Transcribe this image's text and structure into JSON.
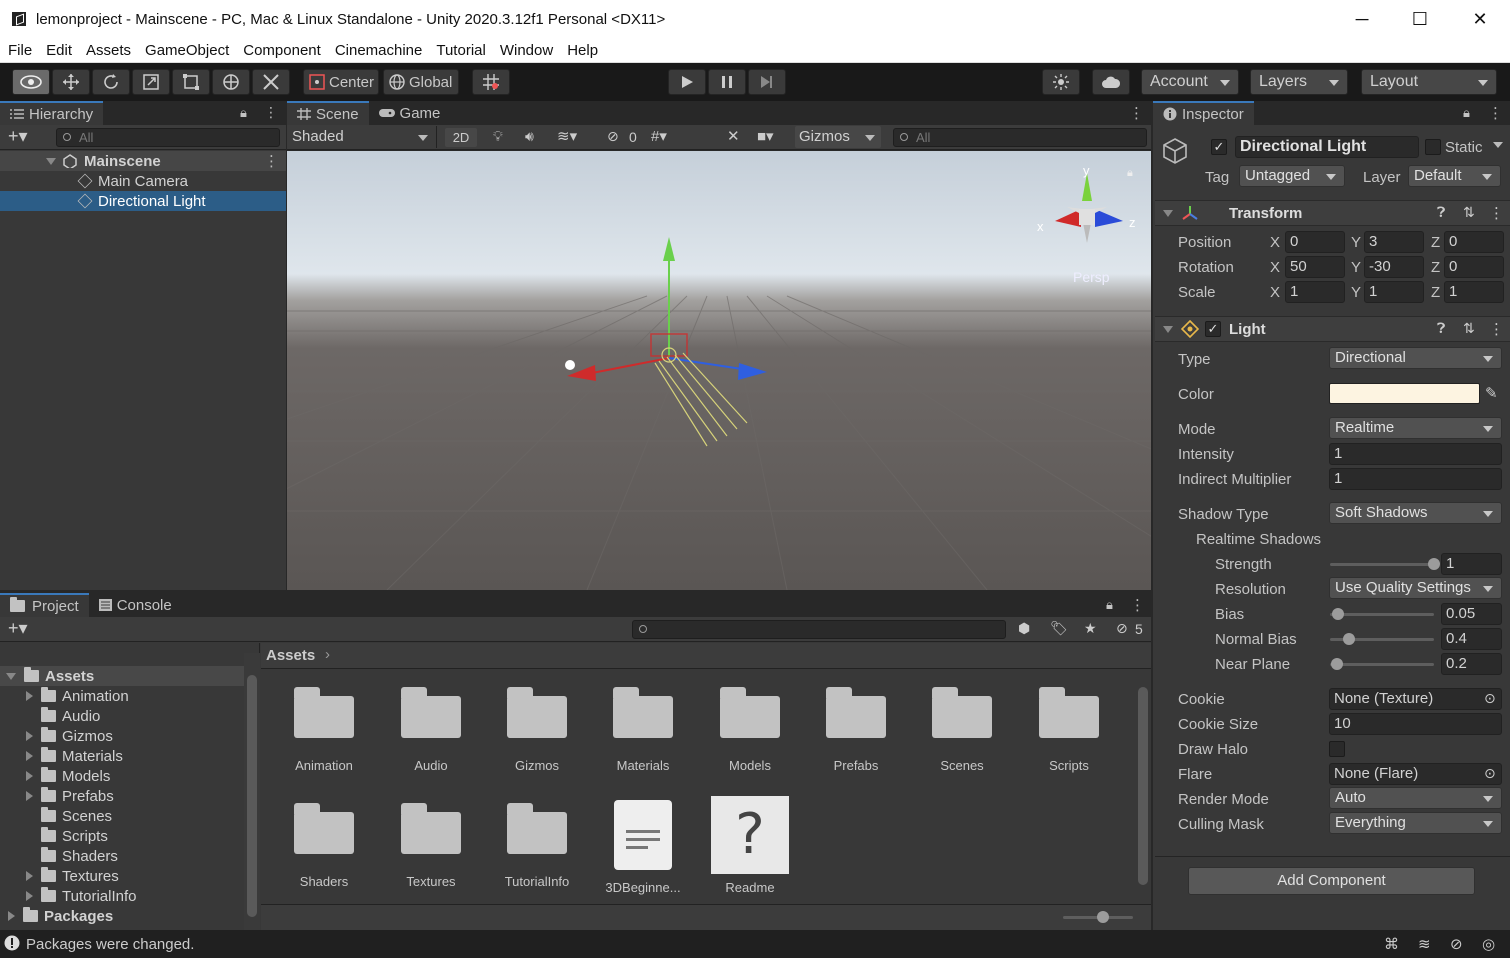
{
  "window": {
    "title": "lemonproject - Mainscene - PC, Mac & Linux Standalone - Unity 2020.3.12f1 Personal <DX11>",
    "minimize": "─",
    "maximize": "☐",
    "close": "✕"
  },
  "menu": [
    "File",
    "Edit",
    "Assets",
    "GameObject",
    "Component",
    "Cinemachine",
    "Tutorial",
    "Window",
    "Help"
  ],
  "toolbar": {
    "pivot": "Center",
    "space": "Global",
    "account": "Account",
    "layers": "Layers",
    "layout": "Layout"
  },
  "hierarchy": {
    "tab": "Hierarchy",
    "search_placeholder": "All",
    "scene": "Mainscene",
    "items": [
      "Main Camera",
      "Directional Light"
    ],
    "selected": "Directional Light"
  },
  "scene": {
    "tabs": [
      "Scene",
      "Game"
    ],
    "shading": "Shaded",
    "mode2d": "2D",
    "hidden_count": "0",
    "gizmos": "Gizmos",
    "search_placeholder": "All",
    "persp": "Persp",
    "axis_y": "y",
    "axis_x": "x",
    "axis_z": "z"
  },
  "inspector": {
    "tab": "Inspector",
    "object_name": "Directional Light",
    "static_label": "Static",
    "tag_label": "Tag",
    "tag": "Untagged",
    "layer_label": "Layer",
    "layer": "Default",
    "transform": {
      "title": "Transform",
      "rows": [
        {
          "label": "Position",
          "x": "0",
          "y": "3",
          "z": "0"
        },
        {
          "label": "Rotation",
          "x": "50",
          "y": "-30",
          "z": "0"
        },
        {
          "label": "Scale",
          "x": "1",
          "y": "1",
          "z": "1"
        }
      ],
      "axis_x": "X",
      "axis_y": "Y",
      "axis_z": "Z"
    },
    "light": {
      "title": "Light",
      "type_label": "Type",
      "type": "Directional",
      "color_label": "Color",
      "color_value": "#fdf4e1",
      "mode_label": "Mode",
      "mode": "Realtime",
      "intensity_label": "Intensity",
      "intensity": "1",
      "indirect_label": "Indirect Multiplier",
      "indirect": "1",
      "shadow_type_label": "Shadow Type",
      "shadow_type": "Soft Shadows",
      "realtime_shadows": "Realtime Shadows",
      "strength_label": "Strength",
      "strength": "1",
      "resolution_label": "Resolution",
      "resolution": "Use Quality Settings",
      "bias_label": "Bias",
      "bias": "0.05",
      "normal_bias_label": "Normal Bias",
      "normal_bias": "0.4",
      "near_plane_label": "Near Plane",
      "near_plane": "0.2",
      "cookie_label": "Cookie",
      "cookie": "None (Texture)",
      "cookie_size_label": "Cookie Size",
      "cookie_size": "10",
      "draw_halo_label": "Draw Halo",
      "flare_label": "Flare",
      "flare": "None (Flare)",
      "render_mode_label": "Render Mode",
      "render_mode": "Auto",
      "culling_mask_label": "Culling Mask",
      "culling_mask": "Everything"
    },
    "add_component": "Add Component"
  },
  "project": {
    "tabs": [
      "Project",
      "Console"
    ],
    "hidden_count": "5",
    "breadcrumb": "Assets",
    "tree_root": "Assets",
    "tree": [
      "Animation",
      "Audio",
      "Gizmos",
      "Materials",
      "Models",
      "Prefabs",
      "Scenes",
      "Scripts",
      "Shaders",
      "Textures",
      "TutorialInfo"
    ],
    "packages": "Packages",
    "grid": [
      "Animation",
      "Audio",
      "Gizmos",
      "Materials",
      "Models",
      "Prefabs",
      "Scenes",
      "Scripts",
      "Shaders",
      "Textures",
      "TutorialInfo",
      "3DBeginne...",
      "Readme"
    ]
  },
  "status": {
    "message": "Packages were changed."
  }
}
